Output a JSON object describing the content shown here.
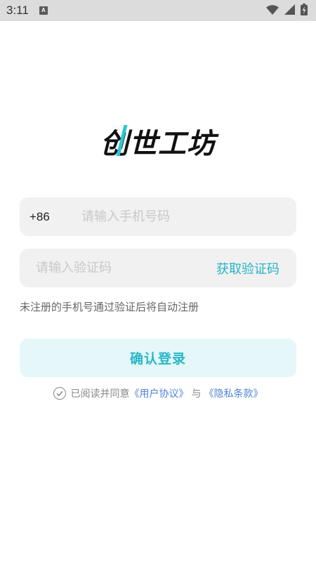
{
  "status_bar": {
    "time": "3:11",
    "notification_badge": "A",
    "icons": [
      "wifi-icon",
      "cellular-signal-icon",
      "battery-charging-icon"
    ]
  },
  "logo": {
    "text": "创世工坊",
    "accent_color": "#29c6d4"
  },
  "phone": {
    "country_code": "+86",
    "placeholder": "请输入手机号码",
    "value": ""
  },
  "code": {
    "placeholder": "请输入验证码",
    "value": "",
    "get_code_label": "获取验证码"
  },
  "hint": "未注册的手机号通过验证后将自动注册",
  "login_button": {
    "label": "确认登录"
  },
  "agreement": {
    "prefix": "已阅读并同意",
    "user_agreement": "《用户协议》",
    "conjunction": "与",
    "privacy_policy": "《隐私条款》",
    "checked": false
  },
  "colors": {
    "accent": "#27b7c8",
    "field_bg": "#f1f1f1",
    "button_bg": "#e5f7f9",
    "link": "#4f83d8"
  }
}
